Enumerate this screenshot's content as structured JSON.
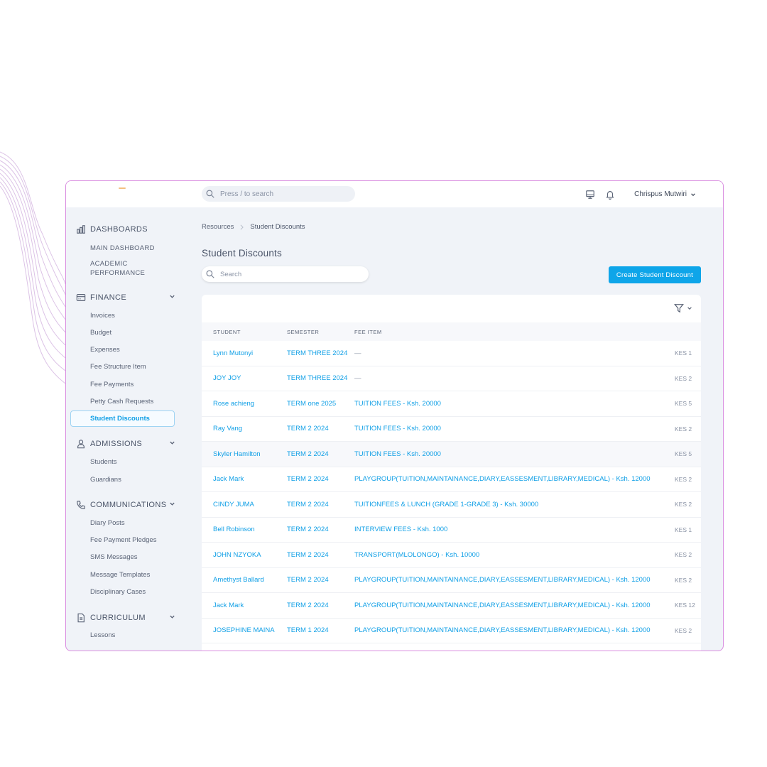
{
  "topbar": {
    "search_placeholder": "Press / to search",
    "icons": [
      "monitor-icon",
      "bell-icon"
    ],
    "user_name": "Chrispus Mutwiri"
  },
  "sidebar": {
    "sections": [
      {
        "label": "DASHBOARDS",
        "icon": "bar-chart-icon",
        "items": [
          "MAIN DASHBOARD",
          "ACADEMIC PERFORMANCE"
        ]
      },
      {
        "label": "FINANCE",
        "icon": "credit-card-icon",
        "items": [
          "Invoices",
          "Budget",
          "Expenses",
          "Fee Structure Item",
          "Fee Payments",
          "Petty Cash Requests",
          "Student Discounts"
        ]
      },
      {
        "label": "ADMISSIONS",
        "icon": "user-icon",
        "items": [
          "Students",
          "Guardians"
        ]
      },
      {
        "label": "COMMUNICATIONS",
        "icon": "phone-icon",
        "items": [
          "Diary Posts",
          "Fee Payment Pledges",
          "SMS Messages",
          "Message Templates",
          "Disciplinary Cases"
        ]
      },
      {
        "label": "CURRICULUM",
        "icon": "document-icon",
        "items": [
          "Lessons"
        ]
      }
    ],
    "active_item": "Student Discounts",
    "academic_line1": "ACADEMIC",
    "academic_line2": "PERFORMANCE"
  },
  "main": {
    "breadcrumb": [
      "Resources",
      "Student Discounts"
    ],
    "title": "Student Discounts",
    "search_placeholder": "Search",
    "create_button": "Create Student Discount",
    "table": {
      "columns": [
        "STUDENT",
        "SEMESTER",
        "FEE ITEM"
      ],
      "rows": [
        {
          "student": "Lynn Mutonyi",
          "semester": "TERM THREE 2024",
          "fee_item": "—",
          "amount": "KES 1"
        },
        {
          "student": "JOY JOY",
          "semester": "TERM THREE 2024",
          "fee_item": "—",
          "amount": "KES 2"
        },
        {
          "student": "Rose achieng",
          "semester": "TERM one 2025",
          "fee_item": "TUITION FEES - Ksh. 20000",
          "amount": "KES 5"
        },
        {
          "student": "Ray Vang",
          "semester": "TERM 2 2024",
          "fee_item": "TUITION FEES - Ksh. 20000",
          "amount": "KES 2"
        },
        {
          "student": "Skyler Hamilton",
          "semester": "TERM 2 2024",
          "fee_item": "TUITION FEES - Ksh. 20000",
          "amount": "KES 5"
        },
        {
          "student": "Jack Mark",
          "semester": "TERM 2 2024",
          "fee_item": "PLAYGROUP(TUITION,MAINTAINANCE,DIARY,EASSESMENT,LIBRARY,MEDICAL) - Ksh. 12000",
          "amount": "KES 2"
        },
        {
          "student": "CINDY JUMA",
          "semester": "TERM 2 2024",
          "fee_item": "TUITIONFEES & LUNCH (GRADE 1-GRADE 3) - Ksh. 30000",
          "amount": "KES 2"
        },
        {
          "student": "Bell Robinson",
          "semester": "TERM 2 2024",
          "fee_item": "INTERVIEW FEES - Ksh. 1000",
          "amount": "KES 1"
        },
        {
          "student": "JOHN NZYOKA",
          "semester": "TERM 2 2024",
          "fee_item": "TRANSPORT(MLOLONGO) - Ksh. 10000",
          "amount": "KES 2"
        },
        {
          "student": "Amethyst Ballard",
          "semester": "TERM 2 2024",
          "fee_item": "PLAYGROUP(TUITION,MAINTAINANCE,DIARY,EASSESMENT,LIBRARY,MEDICAL) - Ksh. 12000",
          "amount": "KES 2"
        },
        {
          "student": "Jack Mark",
          "semester": "TERM 2 2024",
          "fee_item": "PLAYGROUP(TUITION,MAINTAINANCE,DIARY,EASSESMENT,LIBRARY,MEDICAL) - Ksh. 12000",
          "amount": "KES 12"
        },
        {
          "student": "JOSEPHINE MAINA",
          "semester": "TERM 1 2024",
          "fee_item": "PLAYGROUP(TUITION,MAINTAINANCE,DIARY,EASSESMENT,LIBRARY,MEDICAL) - Ksh. 12000",
          "amount": "KES 2"
        }
      ]
    }
  },
  "colors": {
    "accent": "#0ea5e9",
    "link": "#0f9fe6",
    "frame_border": "#d98de0",
    "background": "#f0f3f8"
  }
}
